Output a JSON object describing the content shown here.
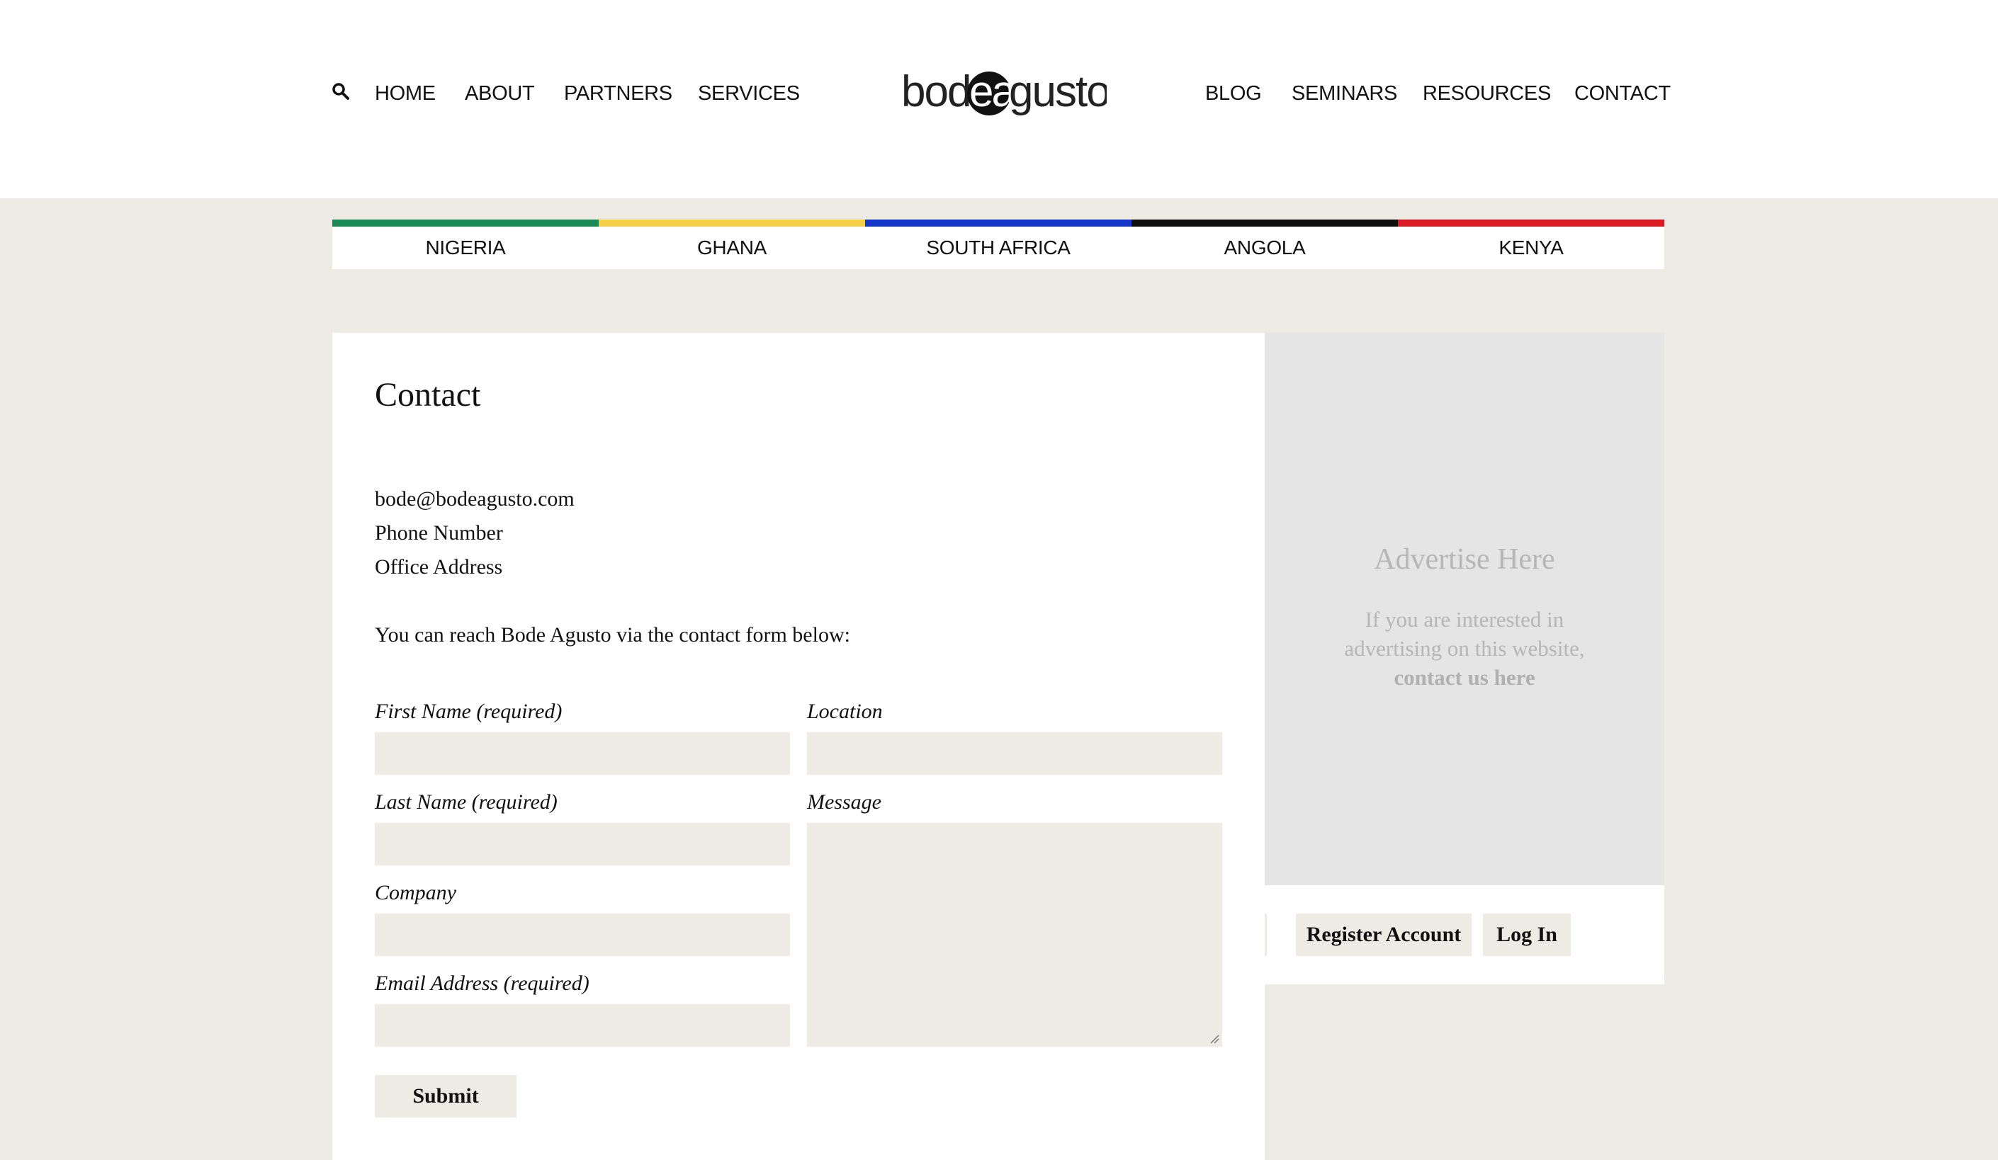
{
  "header": {
    "logo_text_left": "bod",
    "logo_text_circle": "ea",
    "logo_text_right": "gusto",
    "nav_left": [
      "HOME",
      "ABOUT",
      "PARTNERS",
      "SERVICES"
    ],
    "nav_right": [
      "BLOG",
      "SEMINARS",
      "RESOURCES",
      "CONTACT"
    ]
  },
  "countries": [
    {
      "label": "NIGERIA",
      "color": "#1a8a57"
    },
    {
      "label": "GHANA",
      "color": "#f5cf48"
    },
    {
      "label": "SOUTH AFRICA",
      "color": "#1537c9"
    },
    {
      "label": "ANGOLA",
      "color": "#0f0f0f"
    },
    {
      "label": "KENYA",
      "color": "#da1b23"
    }
  ],
  "main": {
    "title": "Contact",
    "email": "bode@bodeagusto.com",
    "phone": "Phone Number",
    "address": "Office Address",
    "intro": "You can reach Bode Agusto via the contact form below:"
  },
  "form": {
    "first_name_label": "First Name (required)",
    "last_name_label": "Last Name (required)",
    "company_label": "Company",
    "email_label": "Email Address (required)",
    "location_label": "Location",
    "message_label": "Message",
    "submit_label": "Submit"
  },
  "ad": {
    "title": "Advertise Here",
    "text_line1": "If you are interested in",
    "text_line2": "advertising on this website,",
    "link": "contact us here"
  },
  "account": {
    "register_label": "Register Account",
    "login_label": "Log In"
  }
}
